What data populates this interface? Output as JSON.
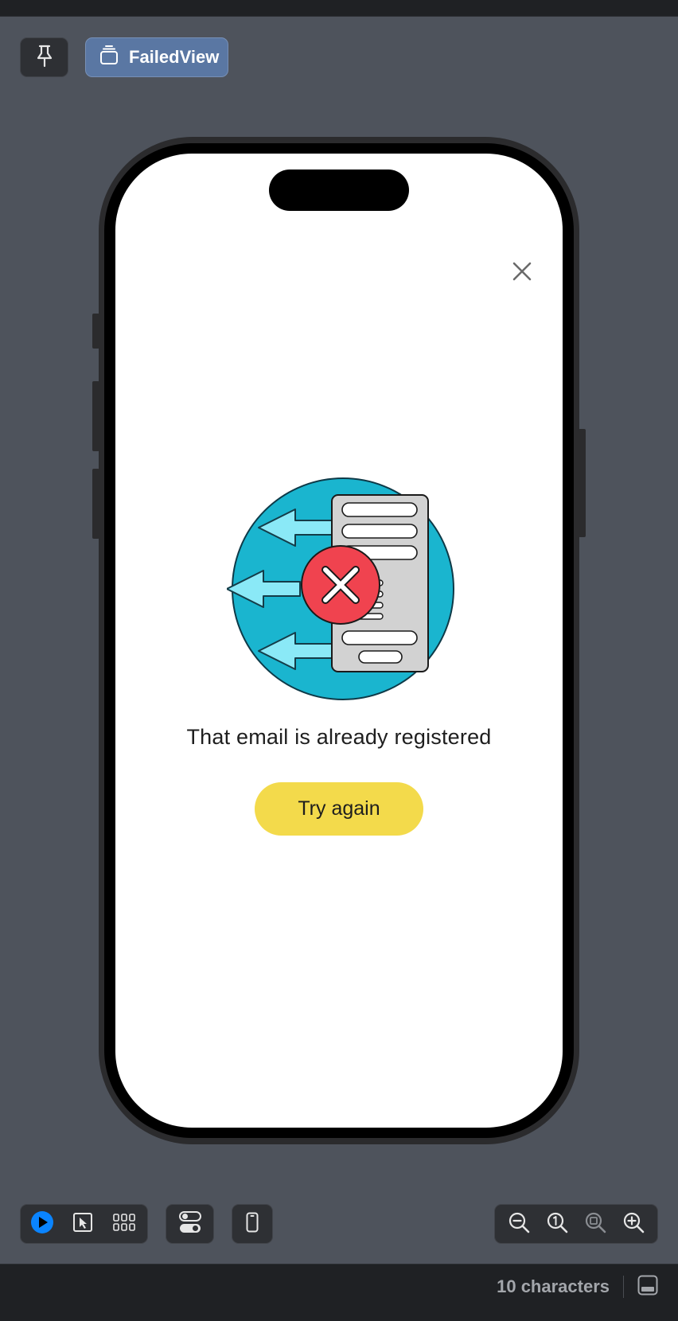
{
  "canvas_header": {
    "pin_icon": "pin-icon",
    "view_icon": "stack-icon",
    "view_name": "FailedView"
  },
  "screen": {
    "close_icon": "close-icon",
    "illustration": "registration-failed-illustration",
    "message": "That email is already registered",
    "button_label": "Try again"
  },
  "colors": {
    "background": "#4e535c",
    "chip": "#5a77a3",
    "accent_blue": "#0a84ff",
    "circle": "#1ab5cf",
    "error_red": "#f0434f",
    "button_yellow": "#f3da4b"
  },
  "toolbar": {
    "left_tools": [
      "live-preview-icon",
      "selectable-icon",
      "variants-icon"
    ],
    "settings_icon": "device-settings-icon",
    "device_icon": "device-icon",
    "zoom_tools": [
      "zoom-out-icon",
      "zoom-100-icon",
      "zoom-to-fit-icon",
      "zoom-in-icon"
    ]
  },
  "status": {
    "characters": "10 characters",
    "panel_icon": "panel-toggle-icon"
  }
}
